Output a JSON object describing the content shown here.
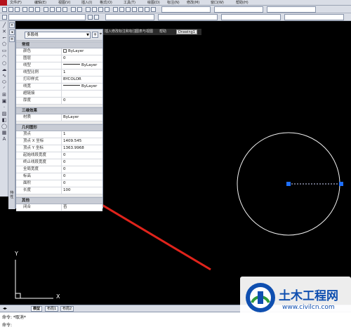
{
  "menu": {
    "items": [
      "文件(F)",
      "编辑(E)",
      "视图(V)",
      "插入(I)",
      "格式(O)",
      "工具(T)",
      "绘图(D)",
      "标注(N)",
      "修改(M)",
      "窗口(W)",
      "帮助(H)"
    ]
  },
  "palette": {
    "object_type": "多段线",
    "sections": {
      "general": "常规",
      "3d": "三维效果",
      "geometry": "几何图形",
      "misc": "其他"
    },
    "general_rows": [
      {
        "name": "颜色",
        "value": "ByLayer"
      },
      {
        "name": "图层",
        "value": "0"
      },
      {
        "name": "线型",
        "value": "ByLayer"
      },
      {
        "name": "线型比例",
        "value": "1"
      },
      {
        "name": "打印样式",
        "value": "BYCOLOR"
      },
      {
        "name": "线宽",
        "value": "ByLayer"
      },
      {
        "name": "超链接",
        "value": ""
      },
      {
        "name": "厚度",
        "value": "0"
      }
    ],
    "material_row": {
      "name": "材质",
      "value": "ByLayer"
    },
    "geometry_rows": [
      {
        "name": "顶点",
        "value": "1"
      },
      {
        "name": "顶点 X 坐标",
        "value": "1409.545"
      },
      {
        "name": "顶点 Y 坐标",
        "value": "1363.9968"
      },
      {
        "name": "起始线段宽度",
        "value": "0"
      },
      {
        "name": "终止线段宽度",
        "value": "0"
      },
      {
        "name": "全局宽度",
        "value": "0"
      },
      {
        "name": "标高",
        "value": "0"
      },
      {
        "name": "面积",
        "value": "0"
      },
      {
        "name": "长度",
        "value": "100"
      }
    ],
    "misc_row": {
      "name": "闭合",
      "value": "否"
    }
  },
  "viewport_tabs": [
    "插入",
    "修改",
    "标注和标注",
    "图表与视图",
    "帮助",
    "Drawing1"
  ],
  "side_label": "特性",
  "ucs": {
    "x": "X",
    "y": "Y"
  },
  "layout_tabs": [
    "模型",
    "布局1",
    "布局2"
  ],
  "command": {
    "line1": "命令: *取消*",
    "line2": "命令:"
  },
  "watermark": {
    "name": "土木工程网",
    "url": "www.civilcn.com"
  },
  "colors": {
    "canvas": "#000000",
    "circle": "#ffffff",
    "grip": "#1e6fff",
    "arrow": "#e0231b",
    "watermark": "#0f4fb0"
  }
}
